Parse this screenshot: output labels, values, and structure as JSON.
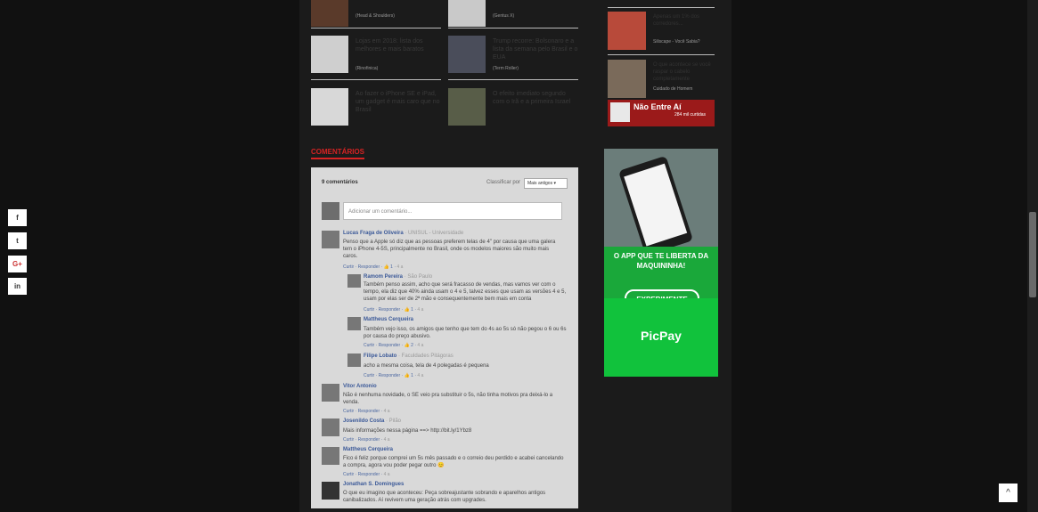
{
  "articles": [
    {
      "title": "",
      "source": "(Head & Shoulders)"
    },
    {
      "title": "",
      "source": "(Gentus X)"
    },
    {
      "title": "Lojas em 2018: lista dos melhores e mais baratos",
      "source": "(Rinofinica)"
    },
    {
      "title": "Trump recorre: Bolsonaro e a lista da semana pelo Brasil e o EUA",
      "source": "(Term Roller)"
    },
    {
      "title": "Ao fazer o iPhone SE e iPad, um gadget é mais caro que no Brasil",
      "source": ""
    },
    {
      "title": "O efeito imediato segundo com o Irã e a primeira Israel",
      "source": ""
    }
  ],
  "comments_section": {
    "title": "COMENTÁRIOS",
    "count": "9 comentários",
    "sort_label": "Classificar por",
    "sort_value": "Mais antigos ▾",
    "input_placeholder": "Adicionar um comentário..."
  },
  "comments": [
    {
      "name": "Lucas Fraga de Oliveira",
      "meta": " · UNISUL - Universidade",
      "text": "Penso que a Apple só diz que as pessoas preferem telas de 4\" por causa que uma galera tem o iPhone 4-5S, principalmente no Brasil, onde os modelos maiores são muito mais caros.",
      "actions": "Curtir · Responder · 👍 1 ·",
      "time": "4 a"
    },
    {
      "name": "Ramom Pereira",
      "meta": " · São Paulo",
      "text": "Também penso assim, acho que será fracasso de vendas, mas vamos ver com o tempo, ela diz que 40% ainda usam o 4 e 5, talvez esses que usam as versões 4 e 5, usam por elas ser de 2ª mão e consequentemente bem mais em conta",
      "actions": "Curtir · Responder · 👍 1 ·",
      "time": "4 a"
    },
    {
      "name": "Mattheus Cerqueira",
      "meta": "",
      "text": "Também vejo isso, os amigos que tenho que tem do 4s ao 5s só não pegou o 6 ou 6s por causa do preço abusivo.",
      "actions": "Curtir · Responder · 👍 2 ·",
      "time": "4 a"
    },
    {
      "name": "Filipe Lobato",
      "meta": " · Faculdades Pitágoras",
      "text": "acho a mesma coisa, tela de 4 polegadas é pequena",
      "actions": "Curtir · Responder · 👍 1 ·",
      "time": "4 a"
    },
    {
      "name": "Vitor Antonio",
      "meta": "",
      "text": "Não é nenhuma novidade, o SE veio pra substituir o 5s, não tinha motivos pra deixá-lo a venda.",
      "actions": "Curtir · Responder ·",
      "time": "4 a"
    },
    {
      "name": "Josenildo Costa",
      "meta": " · Pilão",
      "text": "Mais informações nessa página ==> http://bit.ly/1Ybz8",
      "actions": "Curtir · Responder ·",
      "time": "4 a"
    },
    {
      "name": "Mattheus Cerqueira",
      "meta": "",
      "text": "Fico é feliz porque comprei um 5s mês passado e o correio deu perdido e acabei cancelando a compra, agora vou poder pegar outro 😊",
      "actions": "Curtir · Responder ·",
      "time": "4 a"
    },
    {
      "name": "Jonathan S. Domingues",
      "meta": "",
      "text": "O que eu imagino que aconteceu: Peça sobreajustante sobrando e aparelhos antigos canibalizados. Aí revivem uma geração atrás com upgrades.",
      "actions": "",
      "time": ""
    }
  ],
  "sidebar": {
    "items": [
      {
        "lines": "Apenas um 1% dos corredores...",
        "caption": "Siliscape - Você Sabia?"
      },
      {
        "lines": "O que acontece se você raspar o cabelo completamente",
        "caption": "Cuidado de Homem"
      }
    ],
    "fb_banner": {
      "text": "Não Entre Aí",
      "likes": "284 mil curtidas"
    },
    "ad": {
      "headline": "O APP QUE TE LIBERTA DA MAQUININHA!",
      "cta": "EXPERIMENTE",
      "brand": "PicPay"
    }
  },
  "social": {
    "facebook": "f",
    "twitter": "t",
    "google": "G+",
    "linkedin": "in"
  },
  "back_to_top": "^"
}
